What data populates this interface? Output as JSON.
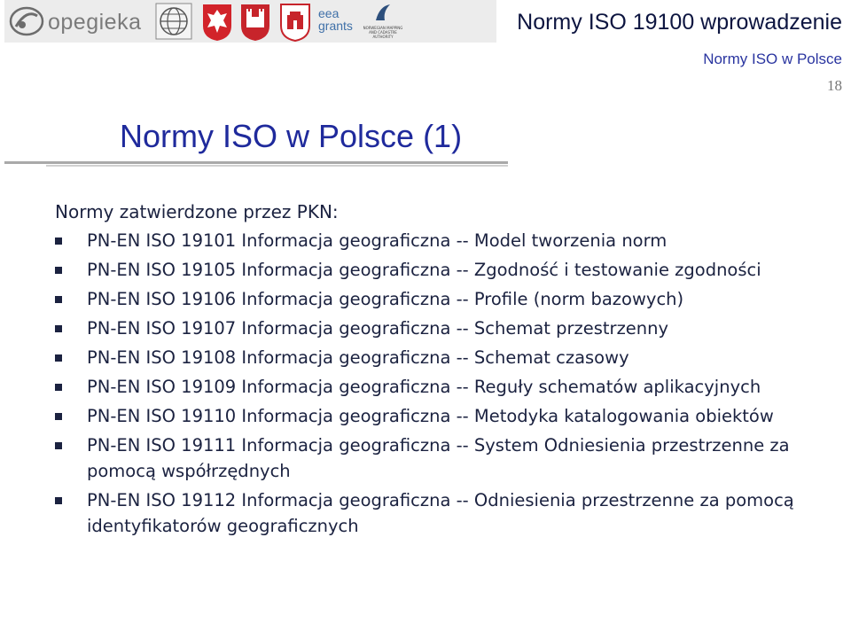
{
  "header": {
    "logo_text": "opegieka",
    "eea_line1": "eea",
    "eea_line2": "grants",
    "nmca_caption": "NORWEGIAN MAPPING AND CADASTRE AUTHORITY",
    "title": "Normy ISO 19100 wprowadzenie",
    "subtitle": "Normy ISO w Polsce",
    "page_number": "18"
  },
  "slide": {
    "title": "Normy ISO w Polsce (1)",
    "intro": "Normy zatwierdzone przez PKN:",
    "items": [
      {
        "text": "PN-EN ISO 19101 Informacja geograficzna -- Model tworzenia norm"
      },
      {
        "text": "PN-EN ISO 19105 Informacja geograficzna -- Zgodność i testowanie zgodności"
      },
      {
        "text": "PN-EN ISO 19106 Informacja geograficzna -- Profile (norm bazowych)"
      },
      {
        "text": "PN-EN ISO 19107 Informacja geograficzna -- Schemat przestrzenny"
      },
      {
        "text": "PN-EN ISO 19108 Informacja geograficzna -- Schemat czasowy"
      },
      {
        "text": "PN-EN ISO 19109 Informacja geograficzna -- Reguły schematów aplikacyjnych"
      },
      {
        "text": "PN-EN ISO 19110 Informacja geograficzna -- Metodyka katalogowania obiektów"
      },
      {
        "text": "PN-EN ISO 19111 Informacja geograficzna -- System Odniesienia przestrzenne za pomocą współrzędnych"
      },
      {
        "text": "PN-EN ISO 19112 Informacja geograficzna -- Odniesienia przestrzenne za pomocą identyfikatorów geograficznych"
      }
    ]
  },
  "colors": {
    "title_blue": "#1f2a9c",
    "body_text": "#1b2240",
    "rule_gray": "#a9a9a9",
    "logo_strip": "#ececec"
  }
}
